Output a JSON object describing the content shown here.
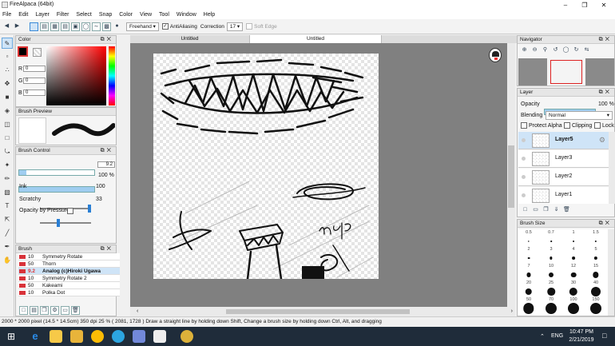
{
  "window": {
    "title": "FireAlpaca (64bit)",
    "minimize_icon": "minimize-icon",
    "maximize_icon": "maximize-icon",
    "close_icon": "close-icon"
  },
  "menu": [
    "File",
    "Edit",
    "Layer",
    "Filter",
    "Select",
    "Snap",
    "Color",
    "View",
    "Tool",
    "Window",
    "Help"
  ],
  "toolbar": {
    "stroke_mode": "Freehand",
    "antialiasing_label": "AntiAliasing",
    "antialiasing_checked": true,
    "correction_label": "Correction",
    "correction_value": "17",
    "soft_edge_label": "Soft Edge",
    "soft_edge_checked": false
  },
  "color_panel": {
    "title": "Color",
    "r_label": "R",
    "r_value": "0",
    "g_label": "G",
    "g_value": "0",
    "b_label": "B",
    "b_value": "0",
    "primary_color": "#000000"
  },
  "brush_preview": {
    "title": "Brush Preview"
  },
  "brush_control": {
    "title": "Brush Control",
    "size_value": "9.2",
    "opacity_value": "100 %",
    "opacity_fraction": 1.0,
    "ink_label": "Ink",
    "ink_value": "100",
    "scratchy_label": "Scratchy",
    "scratchy_value": "33",
    "opacity_pressure_label": "Opacity by Pressure"
  },
  "brush_panel": {
    "title": "Brush",
    "items": [
      {
        "size": "10",
        "name": "Symmetry Rotate",
        "selected": false
      },
      {
        "size": "50",
        "name": "Thorn",
        "selected": false
      },
      {
        "size": "9.2",
        "name": "Analog (c)Hiroki Ugawa",
        "selected": true
      },
      {
        "size": "10",
        "name": "Symmetry Rotate 2",
        "selected": false
      },
      {
        "size": "50",
        "name": "Kakeami",
        "selected": false
      },
      {
        "size": "10",
        "name": "Polka Dot",
        "selected": false
      }
    ]
  },
  "tabs": [
    "Untitled",
    "Untitled"
  ],
  "navigator": {
    "title": "Navigator"
  },
  "layer_panel": {
    "title": "Layer",
    "opacity_label": "Opacity",
    "opacity_value": "100 %",
    "blending_label": "Blending",
    "blending_value": "Normal",
    "protect_alpha_label": "Protect Alpha",
    "clipping_label": "Clipping",
    "lock_label": "Lock",
    "layers": [
      {
        "name": "Layer5",
        "selected": true
      },
      {
        "name": "Layer3",
        "selected": false
      },
      {
        "name": "Layer2",
        "selected": false
      },
      {
        "name": "Layer1",
        "selected": false
      }
    ]
  },
  "brush_size": {
    "title": "Brush Size",
    "sizes": [
      "0.5",
      "0.7",
      "1",
      "1.5",
      "2",
      "3",
      "4",
      "5",
      "7",
      "10",
      "12",
      "15",
      "20",
      "25",
      "30",
      "40",
      "50",
      "70",
      "100",
      "150"
    ]
  },
  "canvas": {
    "handwritten_text": "help"
  },
  "status": "2000 * 2000 pixel  (14.5 * 14.5cm)  350 dpi  25 %  ( 2081, 1728 )  Draw a straight line by holding down Shift, Change a brush size by holding down Ctrl, Alt, and dragging",
  "taskbar": {
    "lang": "ENG",
    "time": "10:47 PM",
    "date": "2/21/2019"
  }
}
